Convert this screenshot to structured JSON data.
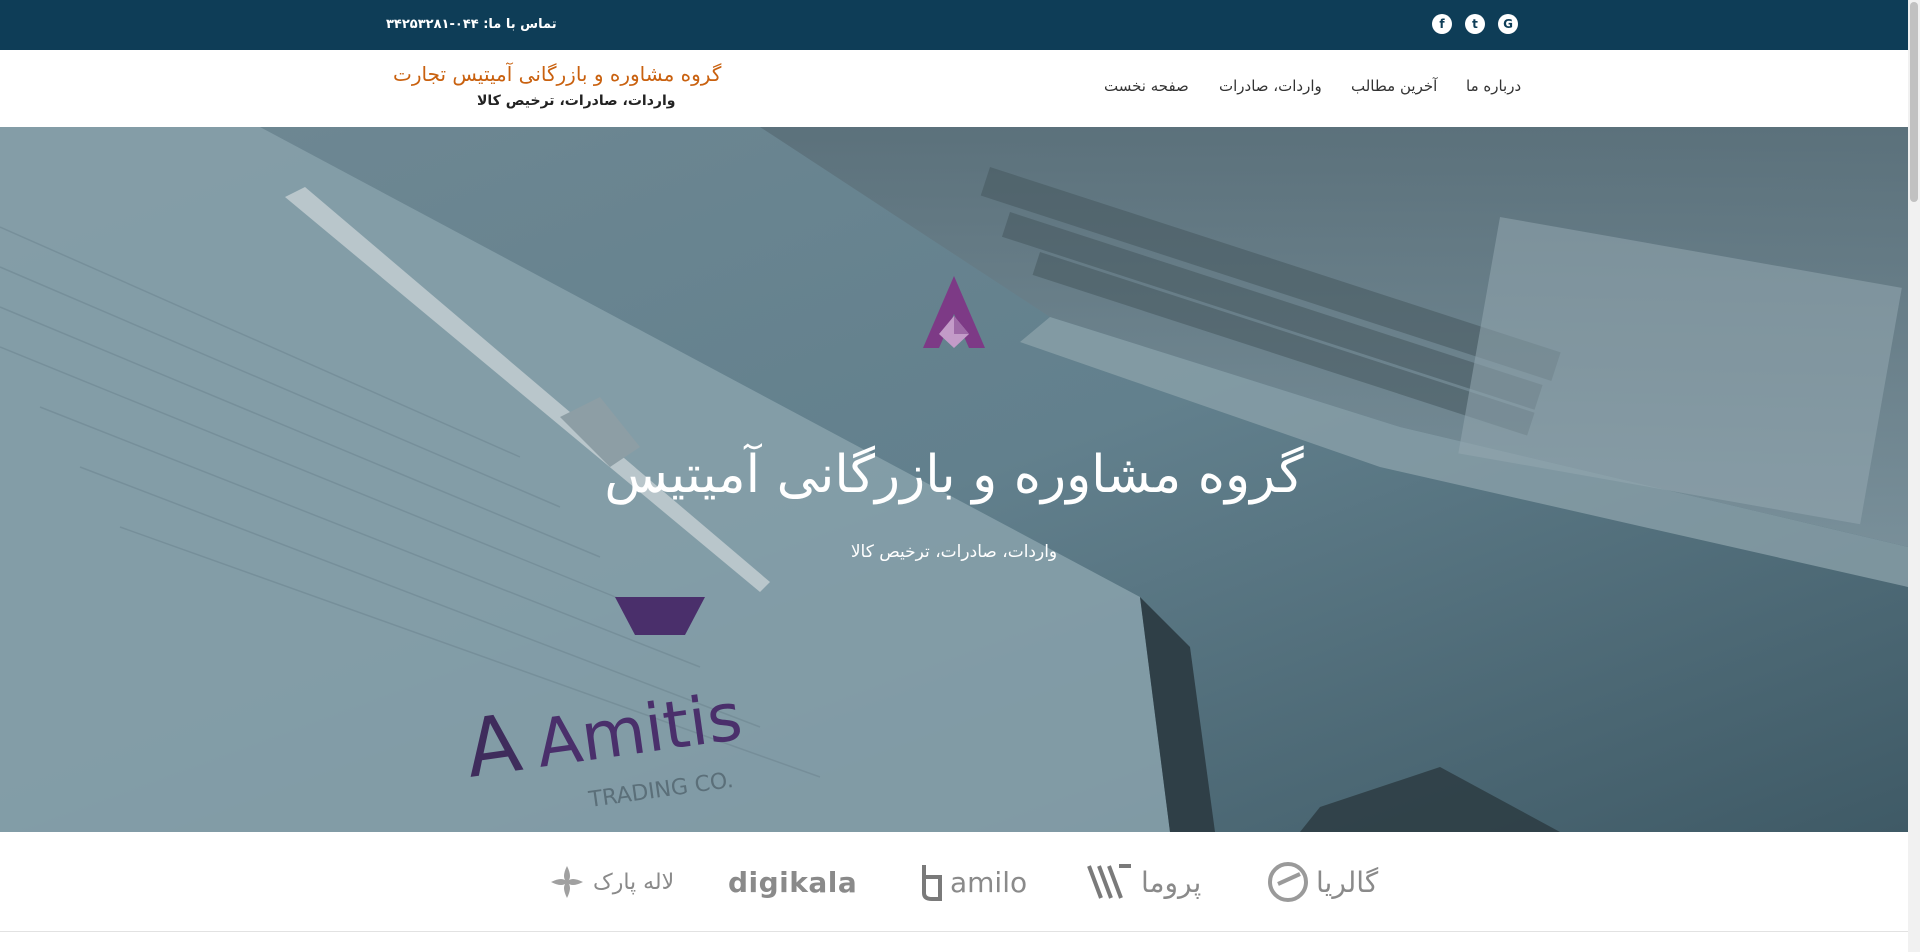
{
  "topbar": {
    "contact_text": "تماس با ما: ۰۴۴-۳۴۲۵۳۲۸۱",
    "social": [
      {
        "icon": "facebook-icon",
        "glyph": "f"
      },
      {
        "icon": "twitter-icon",
        "glyph": "t"
      },
      {
        "icon": "google-plus-icon",
        "glyph": "G"
      }
    ],
    "background": "#0e3d57"
  },
  "header": {
    "brand_title": "گروه مشاوره و بازرگانی آمیتیس تجارت",
    "brand_subtitle": "واردات، صادرات، ترخیص کالا",
    "brand_color": "#c9610f",
    "nav": [
      {
        "label": "درباره ما"
      },
      {
        "label": "آخرین مطالب"
      },
      {
        "label": "واردات، صادرات"
      },
      {
        "label": "صفحه نخست"
      }
    ]
  },
  "hero": {
    "title": "گروه مشاوره و بازرگانی آمیتیس",
    "subtitle": "واردات، صادرات، ترخیص کالا",
    "logo_icon": "amitis-logo-icon",
    "notebook_brand": "Amitis",
    "notebook_tagline": "TRADING CO.",
    "overlay_color": "#5e7a86"
  },
  "partners": [
    {
      "name": "گالریا",
      "icon": "galeria-logo-icon"
    },
    {
      "name": "پروما",
      "icon": "proma-logo-icon"
    },
    {
      "name": "amilo",
      "icon": "bamilo-logo-icon"
    },
    {
      "name": "digikala",
      "icon": "digikala-logo-icon"
    },
    {
      "name": "لاله پارک",
      "icon": "laleh-park-logo-icon"
    }
  ]
}
